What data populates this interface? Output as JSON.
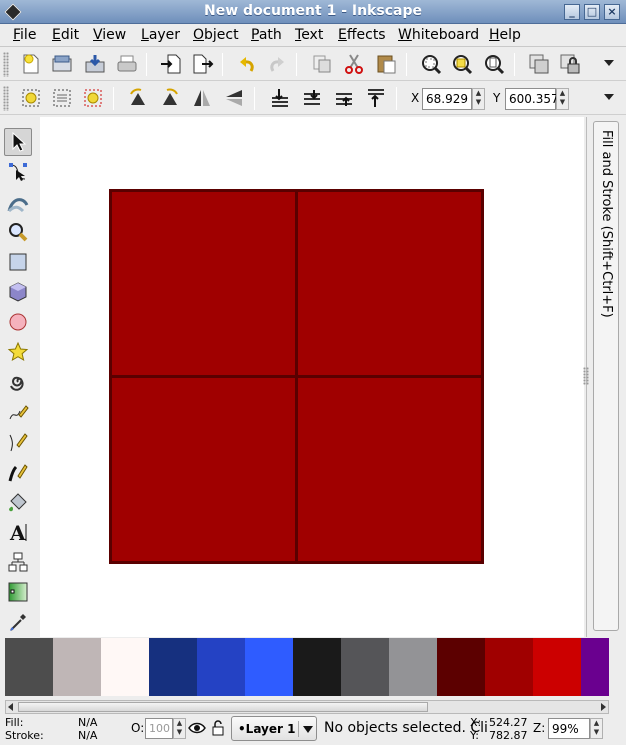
{
  "window": {
    "title": "New document 1 - Inkscape",
    "controls": [
      "minimize",
      "maximize",
      "close"
    ]
  },
  "menubar": {
    "items": [
      "File",
      "Edit",
      "View",
      "Layer",
      "Object",
      "Path",
      "Text",
      "Effects",
      "Whiteboard",
      "Help"
    ]
  },
  "commands_bar": {
    "buttons": [
      "new-document-icon",
      "open-icon",
      "save-icon",
      "print-icon",
      "import-icon",
      "export-icon",
      "undo-icon",
      "redo-icon",
      "duplicate-icon",
      "cut-icon",
      "paste-icon",
      "zoom-selection-icon",
      "zoom-drawing-icon",
      "zoom-page-icon",
      "group-icon",
      "lock-icon"
    ]
  },
  "tool_controls": {
    "x_label": "X",
    "x_value": "68.929",
    "y_label": "Y",
    "y_value": "600.357"
  },
  "toolbox": {
    "tools": [
      "select",
      "node",
      "tweak",
      "zoom",
      "rectangle",
      "3d-box",
      "ellipse",
      "star",
      "spiral",
      "pencil",
      "pen",
      "calligraphy",
      "paint-bucket",
      "text",
      "connector",
      "gradient",
      "dropper"
    ],
    "active": "select"
  },
  "dock": {
    "tab_label": "Fill and Stroke (Shift+Ctrl+F)"
  },
  "palette": {
    "colors": [
      "#4d4d4d",
      "#bfb6b6",
      "#fff8f6",
      "#16307f",
      "#2442c4",
      "#2f5cff",
      "#1a1a1a",
      "#555558",
      "#939396",
      "#5c0000",
      "#a00000",
      "#cc0000",
      "#6a008f"
    ]
  },
  "canvas": {
    "fill_color": "#a00000",
    "stroke_color": "#5a0000"
  },
  "statusbar": {
    "fill_label": "Fill:",
    "fill_value": "N/A",
    "stroke_label": "Stroke:",
    "stroke_value": "N/A",
    "opacity_label": "O:",
    "opacity_value": "100",
    "layer_name": "•Layer 1",
    "message": "No objects selected. Cli",
    "cursor_x_label": "X:",
    "cursor_x": "524.27",
    "cursor_y_label": "Y:",
    "cursor_y": "782.87",
    "zoom_label": "Z:",
    "zoom": "99%"
  }
}
